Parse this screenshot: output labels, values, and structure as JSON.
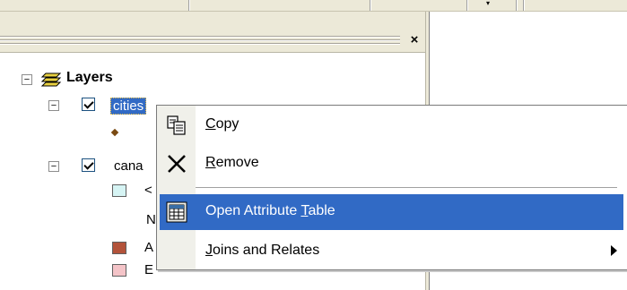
{
  "toc": {
    "close_glyph": "×",
    "layers_label": "Layers",
    "cities_label": "cities",
    "canals_label": "cana",
    "legend_items": [
      {
        "label": "<",
        "color": "#d6f4f4"
      },
      {
        "label": "N",
        "color": null
      },
      {
        "label": "A",
        "color": "#b3533a"
      },
      {
        "label": "E",
        "color": "#f4c4c8"
      }
    ],
    "point_symbol_color": "#7a4a12"
  },
  "context_menu": {
    "items": [
      {
        "label": "Copy",
        "mnemonic": "C",
        "icon": "copy-icon"
      },
      {
        "label": "Remove",
        "mnemonic": "R",
        "icon": "remove-x-icon"
      },
      {
        "label": "Open Attribute Table",
        "mnemonic": "T",
        "icon": "attribute-table-icon",
        "highlighted": true
      },
      {
        "label": "Joins and Relates",
        "mnemonic": "J",
        "icon": null,
        "submenu": true
      }
    ]
  },
  "colors": {
    "selection": "#316ac5",
    "chrome": "#ece9d8"
  }
}
